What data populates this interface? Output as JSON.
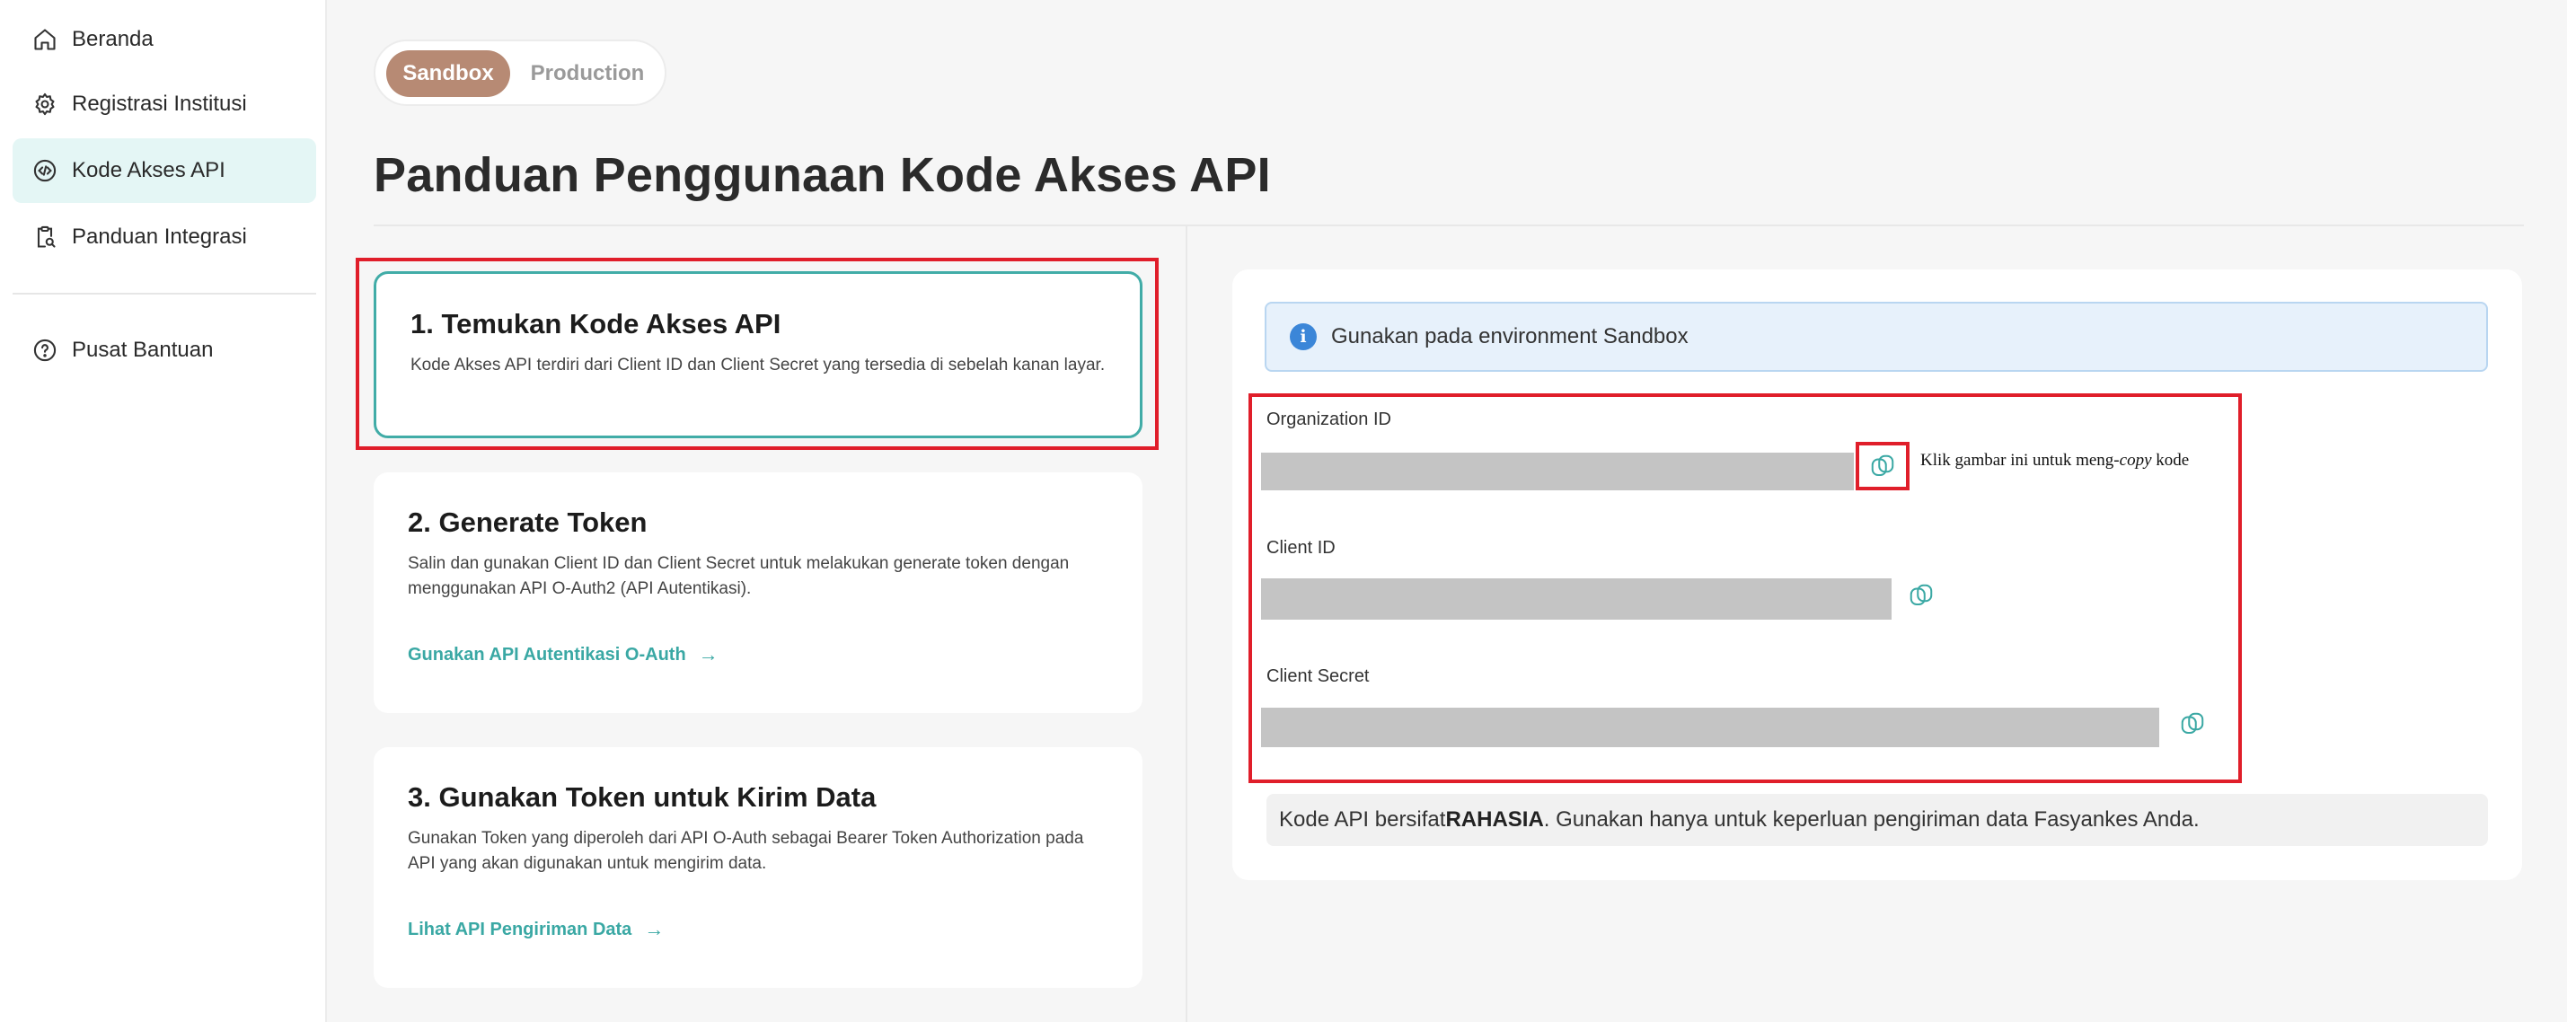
{
  "sidebar": {
    "items": [
      {
        "label": "Beranda",
        "icon": "home-icon"
      },
      {
        "label": "Registrasi Institusi",
        "icon": "gear-icon"
      },
      {
        "label": "Kode Akses API",
        "icon": "code-icon",
        "active": true
      },
      {
        "label": "Panduan Integrasi",
        "icon": "clipboard-search-icon"
      },
      {
        "label": "Pusat Bantuan",
        "icon": "help-circle-icon"
      }
    ]
  },
  "env_toggle": {
    "selected": "Sandbox",
    "other": "Production"
  },
  "page_title": "Panduan Penggunaan Kode Akses API",
  "steps": [
    {
      "title": "1. Temukan Kode Akses API",
      "desc": "Kode Akses API terdiri dari Client ID dan Client Secret yang tersedia di sebelah kanan layar.",
      "link": ""
    },
    {
      "title": "2. Generate Token",
      "desc": "Salin dan gunakan Client ID dan Client Secret untuk melakukan generate token dengan menggunakan API O-Auth2 (API Autentikasi).",
      "link": "Gunakan API Autentikasi O-Auth"
    },
    {
      "title": "3. Gunakan Token untuk Kirim Data",
      "desc": "Gunakan Token yang diperoleh dari API O-Auth sebagai Bearer Token Authorization pada API yang akan digunakan untuk mengirim data.",
      "link": "Lihat API Pengiriman Data"
    }
  ],
  "info_banner": "Gunakan pada environment Sandbox",
  "fields": [
    {
      "label": "Organization ID"
    },
    {
      "label": "Client ID"
    },
    {
      "label": "Client Secret"
    }
  ],
  "annotation": {
    "pre": "Klik gambar ini untuk meng-",
    "em": "copy",
    "post": " kode"
  },
  "note": {
    "pre": "Kode API bersifat ",
    "strong": "RAHASIA",
    "post": ". Gunakan hanya untuk keperluan pengiriman data Fasyankes Anda."
  },
  "colors": {
    "accent": "#3aa8a4",
    "toggle_selected": "#b78a74",
    "highlight": "#e01e2a",
    "info_bg": "#e7f1fb"
  }
}
